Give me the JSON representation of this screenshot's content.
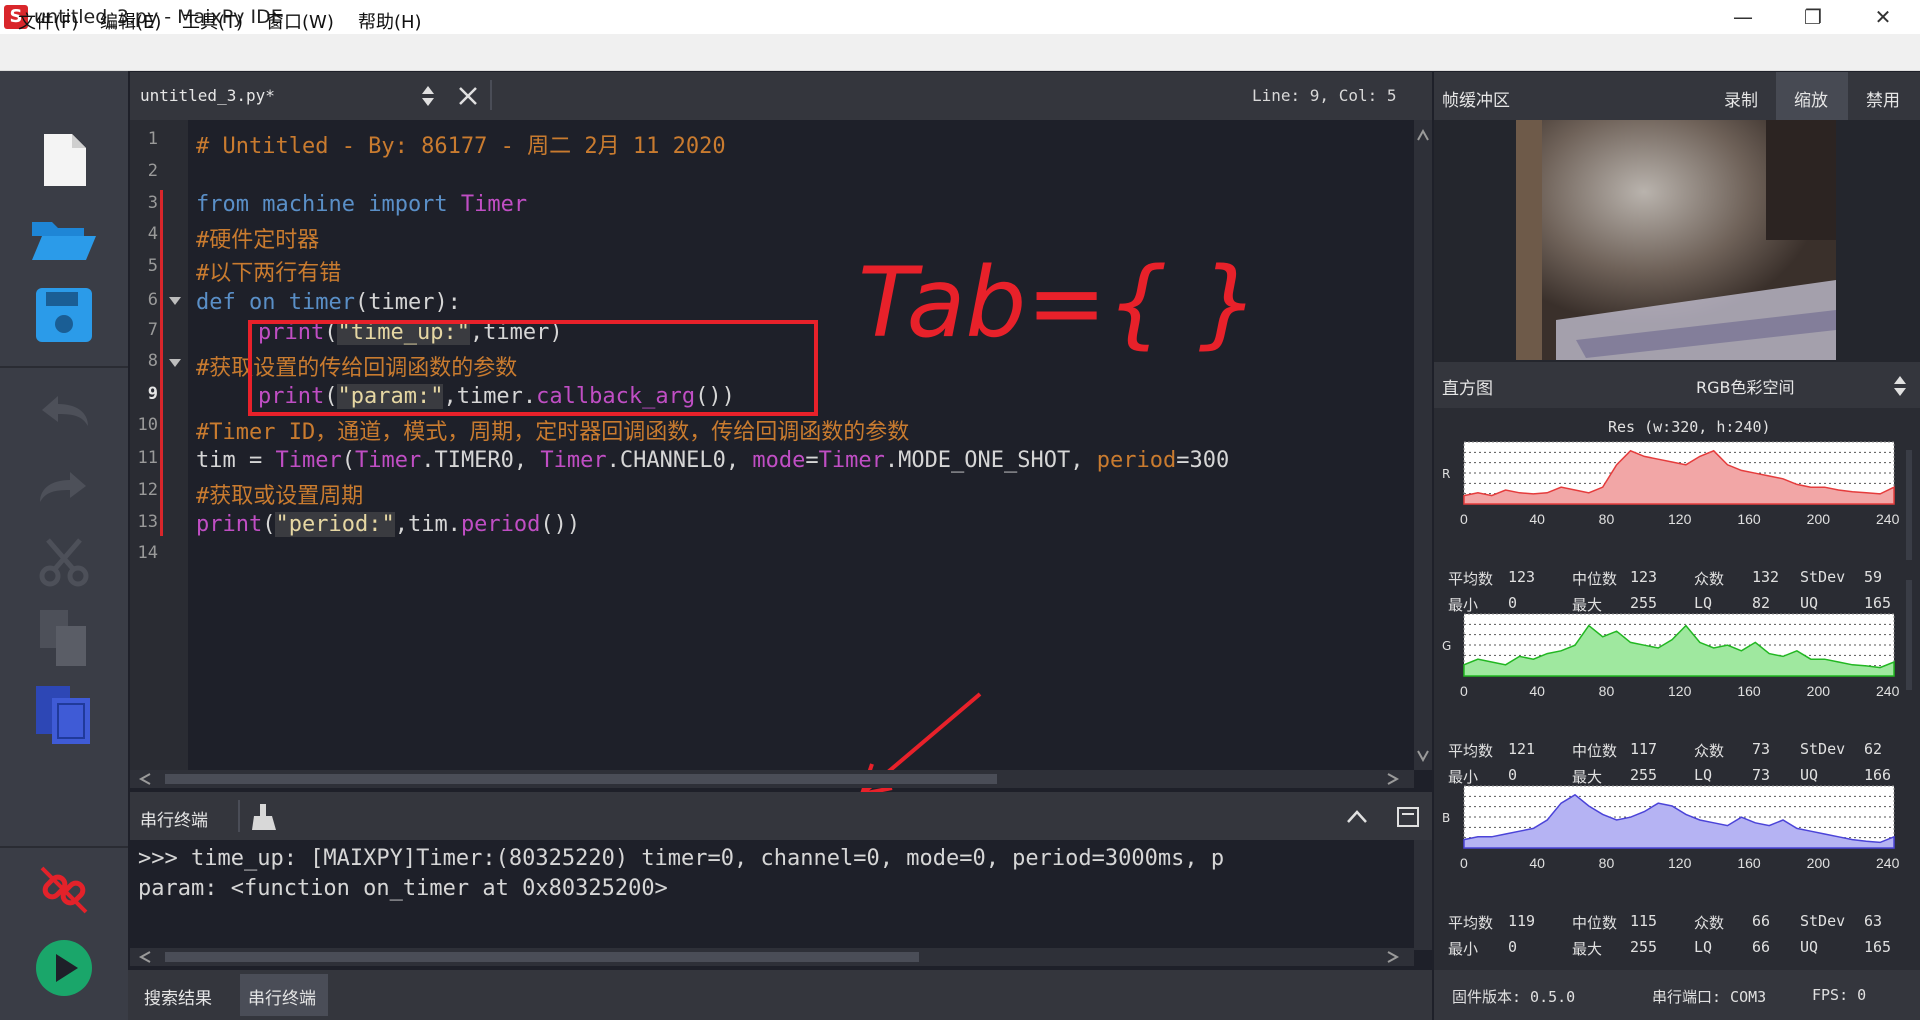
{
  "window": {
    "title": "untitled_3.py - MaixPy IDE",
    "app_icon": "S",
    "minimize": "—",
    "maximize": "❐",
    "close": "✕"
  },
  "menu": [
    "文件(F)",
    "编辑(E)",
    "工具(T)",
    "窗口(W)",
    "帮助(H)"
  ],
  "editor": {
    "file_tab": "untitled_3.py*",
    "cursor": "Line: 9, Col: 5",
    "line_numbers": [
      "1",
      "2",
      "3",
      "4",
      "5",
      "6",
      "7",
      "8",
      "9",
      "10",
      "11",
      "12",
      "13",
      "14"
    ],
    "lines": {
      "l1": "# Untitled - By: 86177 - 周二 2月 11 2020",
      "l3_kw1": "from",
      "l3_mod": " machine ",
      "l3_kw2": "import",
      "l3_cls": " Timer",
      "l4": "#硬件定时器",
      "l5": "#以下两行有错",
      "l6_kw": "def",
      "l6_name": " on timer",
      "l6_rest": "(timer):",
      "l7_fn": "print",
      "l7_p": "(",
      "l7_str": "\"time_up:\"",
      "l7_rest": ",timer)",
      "l8": "#获取设置的传给回调函数的参数",
      "l9_fn": "print",
      "l9_p": "(",
      "l9_str": "\"param:\"",
      "l9_mid": ",timer.",
      "l9_attr": "callback_arg",
      "l9_end": "())",
      "l10": "#Timer ID，通道，模式，周期，定时器回调函数，传给回调函数的参数",
      "l11_a": "tim = ",
      "l11_b": "Timer",
      "l11_c": "(",
      "l11_d": "Timer",
      "l11_e": ".TIMER0, ",
      "l11_f": "Timer",
      "l11_g": ".CHANNEL0, ",
      "l11_h": "mode",
      "l11_i": "=",
      "l11_j": "Timer",
      "l11_k": ".MODE_ONE_SHOT, ",
      "l11_l": "period",
      "l11_m": "=300",
      "l12": "#获取或设置周期",
      "l13_fn": "print",
      "l13_p": "(",
      "l13_str": "\"period:\"",
      "l13_mid": ",tim.",
      "l13_attr": "period",
      "l13_end": "())"
    },
    "annotation": "Tab={ }"
  },
  "terminal": {
    "title": "串行终端",
    "line1": ">>> time_up: [MAIXPY]Timer:(80325220) timer=0, channel=0, mode=0, period=3000ms, p",
    "line2": "param: <function on_timer at 0x80325200>"
  },
  "bottom_tabs": [
    "搜索结果",
    "串行终端"
  ],
  "frame_buffer": {
    "title": "帧缓冲区",
    "buttons": [
      "录制",
      "缩放",
      "禁用"
    ]
  },
  "histogram": {
    "title": "直方图",
    "colorspace": "RGB色彩空间",
    "resolution": "Res (w:320, h:240)",
    "x_ticks": [
      "0",
      "40",
      "80",
      "120",
      "160",
      "200",
      "240"
    ],
    "channels": [
      {
        "name": "R",
        "color": "#f2a6a6",
        "line": "#e53c3c",
        "stats": {
          "avg_label": "平均数",
          "avg": "123",
          "med_label": "中位数",
          "med": "123",
          "mode_label": "众数",
          "mode": "132",
          "std_label": "StDev",
          "std": "59",
          "min_label": "最小",
          "min": "0",
          "max_label": "最大",
          "max": "255",
          "lq_label": "LQ",
          "lq": "82",
          "uq_label": "UQ",
          "uq": "165"
        }
      },
      {
        "name": "G",
        "color": "#9fe89f",
        "line": "#22b722",
        "stats": {
          "avg_label": "平均数",
          "avg": "121",
          "med_label": "中位数",
          "med": "117",
          "mode_label": "众数",
          "mode": "73",
          "std_label": "StDev",
          "std": "62",
          "min_label": "最小",
          "min": "0",
          "max_label": "最大",
          "max": "255",
          "lq_label": "LQ",
          "lq": "73",
          "uq_label": "UQ",
          "uq": "166"
        }
      },
      {
        "name": "B",
        "color": "#b5b3f3",
        "line": "#4b44d8",
        "stats": {
          "avg_label": "平均数",
          "avg": "119",
          "med_label": "中位数",
          "med": "115",
          "mode_label": "众数",
          "mode": "66",
          "std_label": "StDev",
          "std": "63",
          "min_label": "最小",
          "min": "0",
          "max_label": "最大",
          "max": "255",
          "lq_label": "LQ",
          "lq": "66",
          "uq_label": "UQ",
          "uq": "165"
        }
      }
    ]
  },
  "status": {
    "firmware": "固件版本: 0.5.0",
    "port": "串行端口: COM3",
    "fps": "FPS: 0"
  },
  "colors": {
    "accent_blue": "#1e86d6",
    "annotation_red": "#e8212a",
    "run_green": "#1aa66a"
  }
}
